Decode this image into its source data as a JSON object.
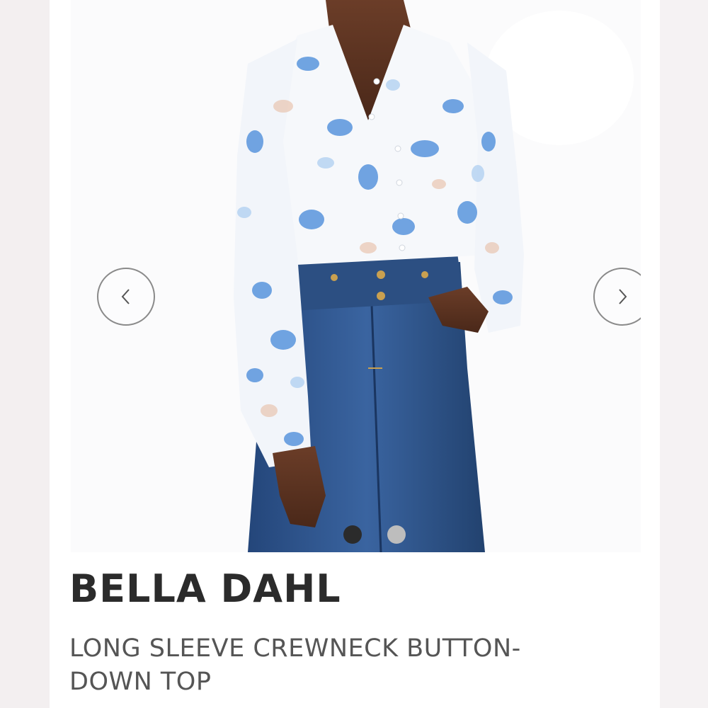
{
  "product": {
    "brand": "BELLA DAHL",
    "title": "LONG SLEEVE CREWNECK BUTTON-DOWN TOP"
  },
  "gallery": {
    "image_description": "model wearing white floral blouse with high-waisted wide-leg jeans",
    "prev_icon": "chevron-left-icon",
    "next_icon": "chevron-right-icon",
    "slide_count": 2,
    "active_slide": 1
  },
  "colors": {
    "dot_active": "#2b2b2b",
    "dot_inactive": "#bdbdbd",
    "blouse": "#f6f8fb",
    "floral_blue": "#4f8fdb",
    "denim": "#2f5485"
  }
}
